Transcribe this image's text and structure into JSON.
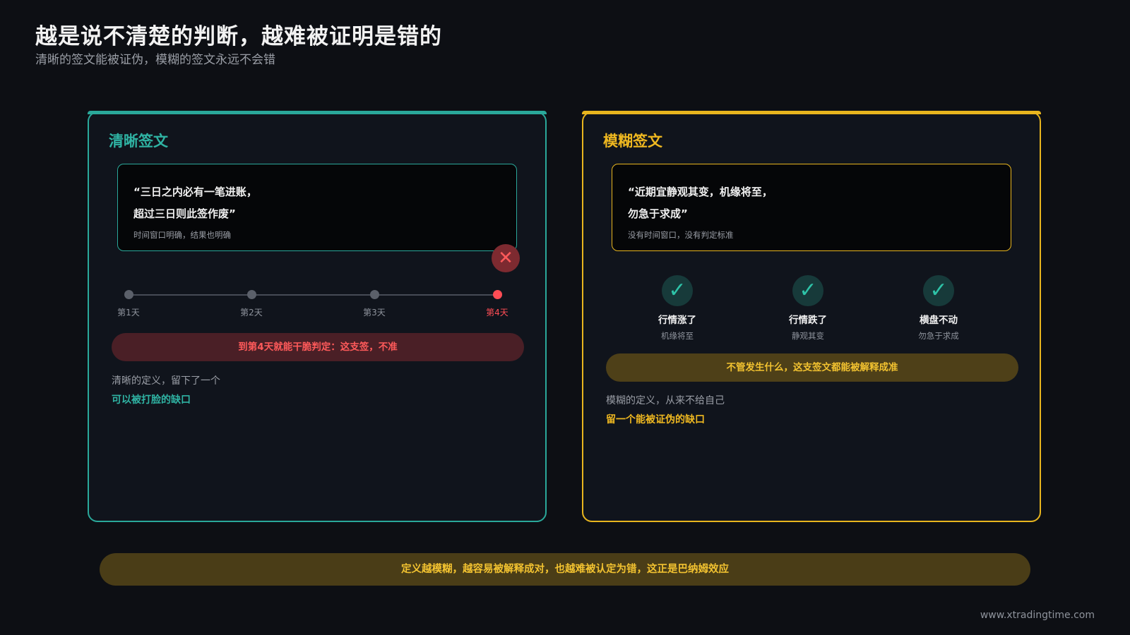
{
  "header": {
    "title": "越是说不清楚的判断，越难被证明是错的",
    "subtitle": "清晰的签文能被证伪，模糊的签文永远不会错"
  },
  "clear_card": {
    "title": "清晰签文",
    "quote_line1": "“三日之内必有一笔进账，",
    "quote_line2": "超过三日则此签作废”",
    "quote_note": "时间窗口明确，结果也明确",
    "timeline": [
      {
        "label": "第1天",
        "status": "neutral"
      },
      {
        "label": "第2天",
        "status": "neutral"
      },
      {
        "label": "第3天",
        "status": "neutral"
      },
      {
        "label": "第4天",
        "status": "failed"
      }
    ],
    "fail_icon": "close-x-icon",
    "verdict": "到第4天就能干脆判定：这支签，不准",
    "note_line1": "清晰的定义，留下了一个",
    "note_line2": "可以被打脸的缺口"
  },
  "vague_card": {
    "title": "模糊签文",
    "quote_line1": "“近期宜静观其变，机缘将至，",
    "quote_line2": "勿急于求成”",
    "quote_note": "没有时间窗口，没有判定标准",
    "outcomes": [
      {
        "label": "行情涨了",
        "sub": "机缘将至",
        "icon": "check-icon"
      },
      {
        "label": "行情跌了",
        "sub": "静观其变",
        "icon": "check-icon"
      },
      {
        "label": "横盘不动",
        "sub": "勿急于求成",
        "icon": "check-icon"
      }
    ],
    "verdict": "不管发生什么，这支签文都能被解释成准",
    "note_line1": "模糊的定义，从来不给自己",
    "note_line2": "留一个能被证伪的缺口"
  },
  "bottom_banner": "定义越模糊，越容易被解释成对，也越难被认定为错，这正是巴纳姆效应",
  "footer_url": "www.xtradingtime.com",
  "colors": {
    "background": "#0d0f14",
    "teal": "#2aa89a",
    "gold": "#e8b51e",
    "red": "#ff4d55"
  }
}
